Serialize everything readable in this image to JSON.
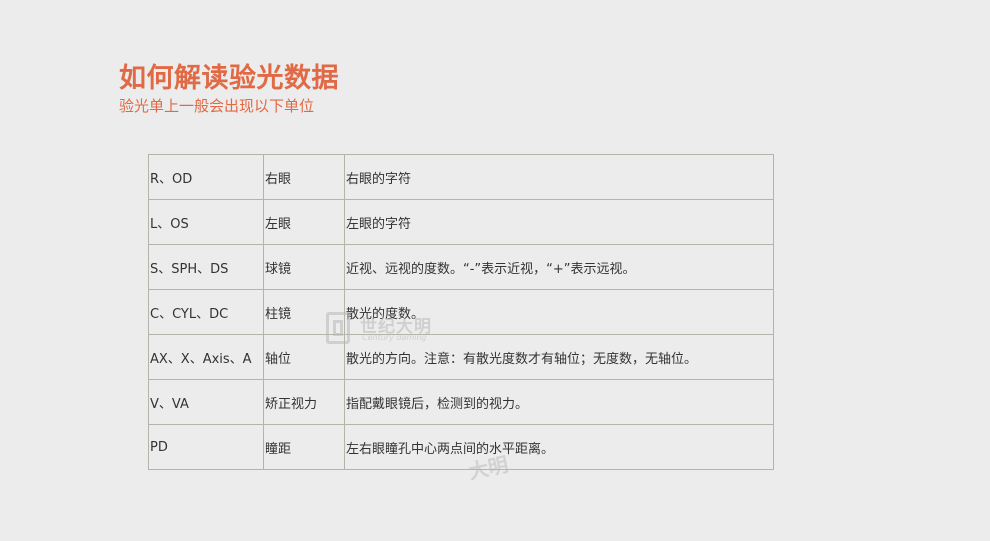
{
  "header": {
    "title": "如何解读验光数据",
    "subtitle": "验光单上一般会出现以下单位"
  },
  "table": {
    "rows": [
      {
        "code": "R、OD",
        "name": "右眼",
        "desc": "右眼的字符"
      },
      {
        "code": "L、OS",
        "name": "左眼",
        "desc": "左眼的字符"
      },
      {
        "code": "S、SPH、DS",
        "name": "球镜",
        "desc": "近视、远视的度数。“-”表示近视，“+”表示远视。"
      },
      {
        "code": "C、CYL、DC",
        "name": "柱镜",
        "desc": "散光的度数。"
      },
      {
        "code": "AX、X、Axis、A",
        "name": "轴位",
        "desc": "散光的方向。注意：有散光度数才有轴位；无度数，无轴位。"
      },
      {
        "code": "V、VA",
        "name": "矫正视力",
        "desc": "指配戴眼镜后，检测到的视力。"
      },
      {
        "code": "PD",
        "name": "瞳距",
        "desc": "左右眼瞳孔中心两点间的水平距离。"
      }
    ]
  },
  "watermark": {
    "cn": "世纪大明",
    "en": "Century daming",
    "fragment": "大明"
  }
}
